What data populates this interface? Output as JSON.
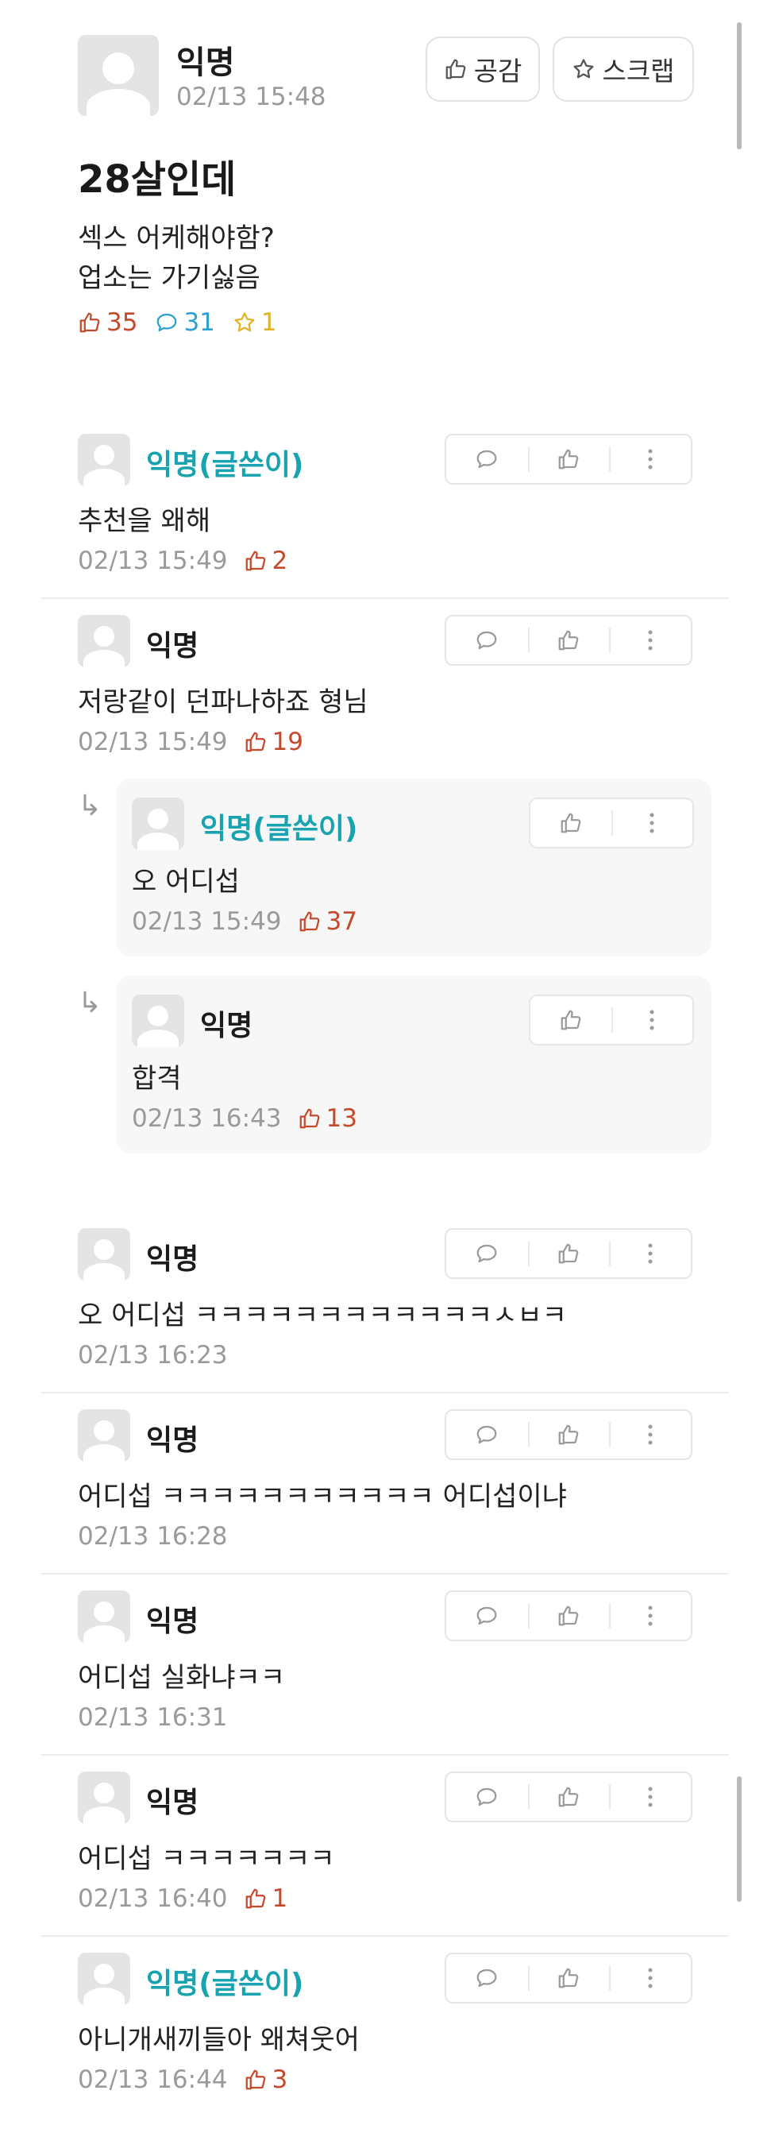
{
  "post": {
    "author": "익명",
    "time": "02/13 15:48",
    "title": "28살인데",
    "body_line1": "섹스 어케해야함?",
    "body_line2": "업소는 가기싫음",
    "likes": "35",
    "comments": "31",
    "scraps": "1",
    "like_button": "공감",
    "scrap_button": "스크랩"
  },
  "comments": [
    {
      "name": "익명(글쓴이)",
      "text": "추천을 왜해",
      "time": "02/13 15:49",
      "likes": "2"
    },
    {
      "name": "익명",
      "text": "저랑같이 던파나하죠 형님",
      "time": "02/13 15:49",
      "likes": "19"
    },
    {
      "name": "익명(글쓴이)",
      "text": "오 어디섭",
      "time": "02/13 15:49",
      "likes": "37"
    },
    {
      "name": "익명",
      "text": "합격",
      "time": "02/13 16:43",
      "likes": "13"
    },
    {
      "name": "익명",
      "text": "오 어디섭 ㅋㅋㅋㅋㅋㅋㅋㅋㅋㅋㅋㅋㅅㅂㅋ",
      "time": "02/13 16:23",
      "likes": ""
    },
    {
      "name": "익명",
      "text": "어디섭 ㅋㅋㅋㅋㅋㅋㅋㅋㅋㅋㅋ 어디섭이냐",
      "time": "02/13 16:28",
      "likes": ""
    },
    {
      "name": "익명",
      "text": "어디섭 실화냐ㅋㅋ",
      "time": "02/13 16:31",
      "likes": ""
    },
    {
      "name": "익명",
      "text": "어디섭 ㅋㅋㅋㅋㅋㅋㅋ",
      "time": "02/13 16:40",
      "likes": "1"
    },
    {
      "name": "익명(글쓴이)",
      "text": "아니개새끼들아 왜쳐웃어",
      "time": "02/13 16:44",
      "likes": "3"
    }
  ],
  "colors": {
    "author": "#19a3b0",
    "like": "#c44a2c",
    "comment": "#2d9fd0",
    "scrap": "#e3b324"
  },
  "icons": [
    "thumbs-up-icon",
    "speech-bubble-icon",
    "star-icon",
    "more-vertical-icon",
    "reply-arrow-icon"
  ]
}
